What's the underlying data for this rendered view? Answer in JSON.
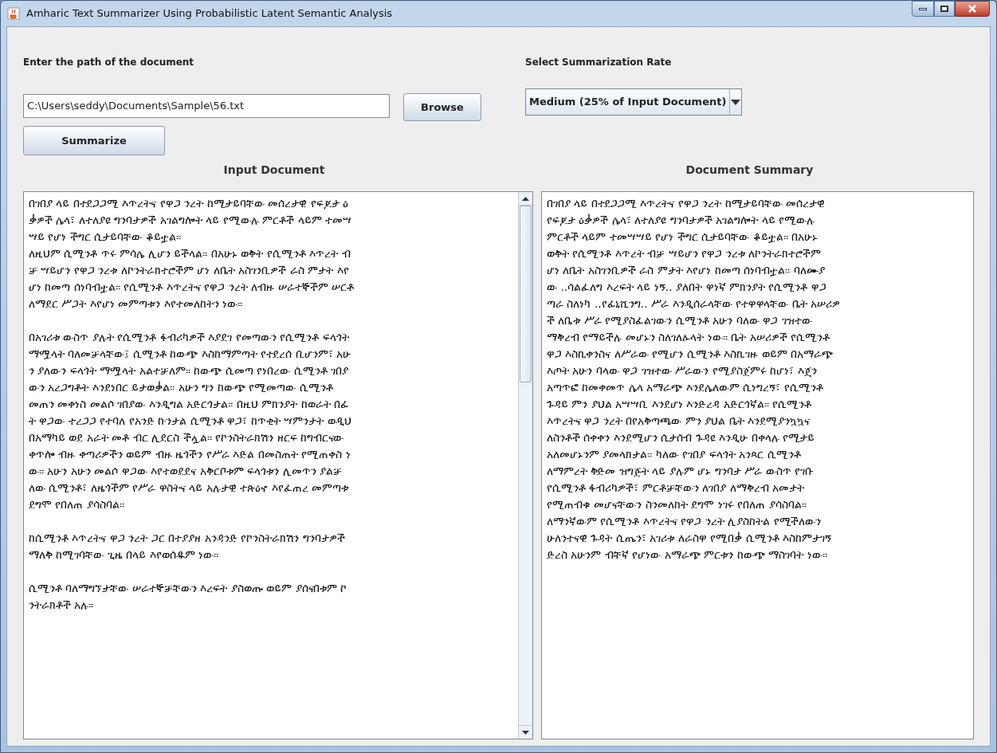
{
  "window": {
    "title": "Amharic Text Summarizer Using Probabilistic Latent Semantic Analysis"
  },
  "path_label": "Enter the path of the document",
  "path_field": {
    "value": "C:\\Users\\seddy\\Documents\\Sample\\56.txt"
  },
  "browse_button": "Browse",
  "rate_label": "Select Summarization Rate",
  "rate_select": {
    "value": "Medium (25% of Input Document)"
  },
  "summarize_button": "Summarize",
  "input_heading": "Input Document",
  "summary_heading": "Document Summary",
  "input_paragraphs": [
    [
      "በገበያ ላይ በተደጋጋሚ እጥረትና የዋጋ ንረት ከሚታይባቸው መሰረታዊ የፍጆታ ዕ",
      "ቃዎች ሌላ፣ ለተለያዩ ግንባታዎች አገልግሎት ላይ የሚውሉ ምርቶች ላይም ተመሣ",
      "ሣይ የሆነ ችግር ሲታይባቸው ቆይቷል፡፡",
      "ለዚህም ሲሚንቶ ጥሩ ምሳሌ ሊሆን ይችላል፡፡ በአሁኑ ወቅት የሲሚንቶ እጥረት ብ",
      "ቻ ሣይሆን የዋጋ ንረቱ ለኮንትራክተሮችም ሆነ ለቤት አስገንቢዎች ራስ ምታት እየ",
      "ሆነ ከመጣ ሰነባብቷል፡፡ የሲሚንቶ እጥረትና የዋጋ ንረት ለብዙ ሠራተኞችም ሠርቶ",
      "ለማደር ሥጋት እየሆነ መምጣቱን እየተመለከትን ነው፡፡"
    ],
    [
      "በአገሪቱ ውስጥ ያሉት የሲሚንቶ ፋብሪካዎች እያደገ የመጣውን የሲሚንቶ ፍላጎት",
      "ማሟላት ባለመቻላቸው፤ ሲሚንቶ ከውጭ እስከማምጣት የተደረሰ ቢሆንም፣ አሁ",
      "ን ያለውን ፍላጎት ማሟላት አልተቻለም፡፡ ከውጭ ሲመጣ የነበረው ሲሚንቶ ገበያ",
      "ውን አረጋግቶት እንደነበር ይታወቃል፡፡ አሁን ግን ከውጭ የሚመጣው ሲሚንቶ",
      "መጠን መቀነስ መልሶ ገበያው እንዲግል አድርጎታል፡፡ በዚህ ምክንያት ከወራት በፊ",
      "ት ዋጋው ተረጋጋ የተባለ የአንድ ኩንታል ሲሚንቶ ዋጋ፣ ከጥቂት ሣምንታት ወዲህ",
      "በአማካይ ወደ አራት መቶ ብር ሊደርስ ችሏል፡፡ የኮንስትራክሽን ዘርፍ ከግብርናው",
      "ቀጥሎ ብዙ ቀጣሪዎችን ወይም ብዙ ዜጎችን የሥራ እድል በመስጠት የሚጠቀስ ነ",
      "ው፡፡ አሁን አሁን መልሶ ዋጋው እየተወደደና አቅርቦቱም ፍላጎቱን ሊመጥን ያልቻ",
      "ለው ሲሚንቶ፣ ለዜጎችም የሥራ ዋስትና ላይ አሉታዊ ተጽዕኖ እየፈጠረ መምጣቱ",
      "ደግሞ የበለጠ ያሳስባል፡፡"
    ],
    [
      "ከሲሚንቶ እጥረትና ዋጋ ንረት ጋር በተያያዘ አንዳንድ የኮንስትራክሽን ግንባታዎች",
      "ማለቅ ከሚገባቸው ጊዜ በላይ እየወሰዱም ነው፡፡"
    ],
    [
      "ሲሚንቶ ባለማግኘታቸው ሠራተኞቻቸውን እረፍት ያስወጡ ወይም ያሰናበቱም ኮ",
      "ንትራክቶች አሉ፡፡"
    ]
  ],
  "summary_lines": [
    "በገበያ ላይ በተደጋጋሚ እጥረትና የዋጋ ንረት ከሚታይባቸው መሰረታዊ",
    "የፍጆታ ዕቃዎች ሌላ፣ ለተለያዩ ግንባታዎች አገልግሎት ላይ የሚውሉ",
    "ምርቶች ላይም ተመሣሣይ የሆነ ችግር ሲታይባቸው ቆይቷል፡፡ በአሁኑ",
    "ወቅት የሲሚንቶ እጥረት ብቻ ሣይሆን የዋጋ ንረቱ ለኮንትራክተሮችም",
    "ሆነ ለቤት አስገንቢዎች ራስ ምታት እየሆነ ከመጣ ሰነባብቷል፡፡ ባለሙያ",
    "ው ..ሳልፈለግ እረፍት ላይ ነኝ.. ያለበት ዋነኛ ምክንያት የሲሚንቶ ዋጋ",
    "ጣራ ስለነካ ..የፊኒሺንግ.. ሥራ እንዲሰራላቸው የተዋዋላቸው ቤት አሠሪዎ",
    "ች ለቤቱ ሥራ የሚያስፈልገውን ሲሚንቶ አሁን ባለው ዋጋ ገዝተው",
    "ማቅረብ የማይችሉ መሆኑን ስለገለፁላት ነው፡፡ ቤት አሠሪዎች የሲሚንቶ",
    "ዋጋ እስኪቀንስና ለሥራው የሚሆን ሲሚንቶ እስኪገዙ ወይም በአማራጭ",
    "እጦት አሁን ባላው ዋጋ ገዝተው ሥራውን የሚያስጀምሩ ከሆነ፣ እጄን",
    "አጣጥፎ ከመቀመጥ ሌላ አማራጭ እንደሌለውም ሲነግረኝ፣ የሲሚንቶ",
    "ጉዳይ ምን ያህል አሣሣቢ እንደሆነ እንድረዳ አድርጎኛል፡፡ የሲሚንቶ",
    "እጥረትና ዋጋ ንረት በየአቅጣጫው ምን ያህል ቤት እንደሚያንኳኳና",
    "ለስንቶች ሰቀቀን እንደሚሆን ሲታሰብ ጉዳዩ እንዲሁ በቀላሉ የሚታይ",
    "አለመሆኑንም ያመላክታል፡፡ ካለው የገበያ ፍላጎት አንጻር ሲሚንቶ",
    "ለማምረት ቅድመ ዝግጅት ላይ ያሉም ሆኑ ግንባታ ሥራ ውስጥ የገቡ",
    "የሲሚንቶ ፋብሪካዎች፣ ምርቶቻቸውን ለገበያ ለማቅረብ አመታት",
    "የሚጠብቁ መሆናቸውን ስንመለከት ደግሞ ነገሩ የበለጠ ያሳስባል፡፡",
    "ለማንኛውም የሲሚንቶ እጥረትና የዋጋ ንረት ሊያስከትል የሚችለውን",
    "ሁለንተናዊ ጉዳት ሲጤን፣ አገሪቱ ለራስዋ የሚበቃ ሲሚንቶ እስከምታገኝ",
    "ድረስ አሁንም ብቸኛ የሆነው አማራጭ ምርቱን ከውጭ ማስገባት ነው፡፡"
  ]
}
